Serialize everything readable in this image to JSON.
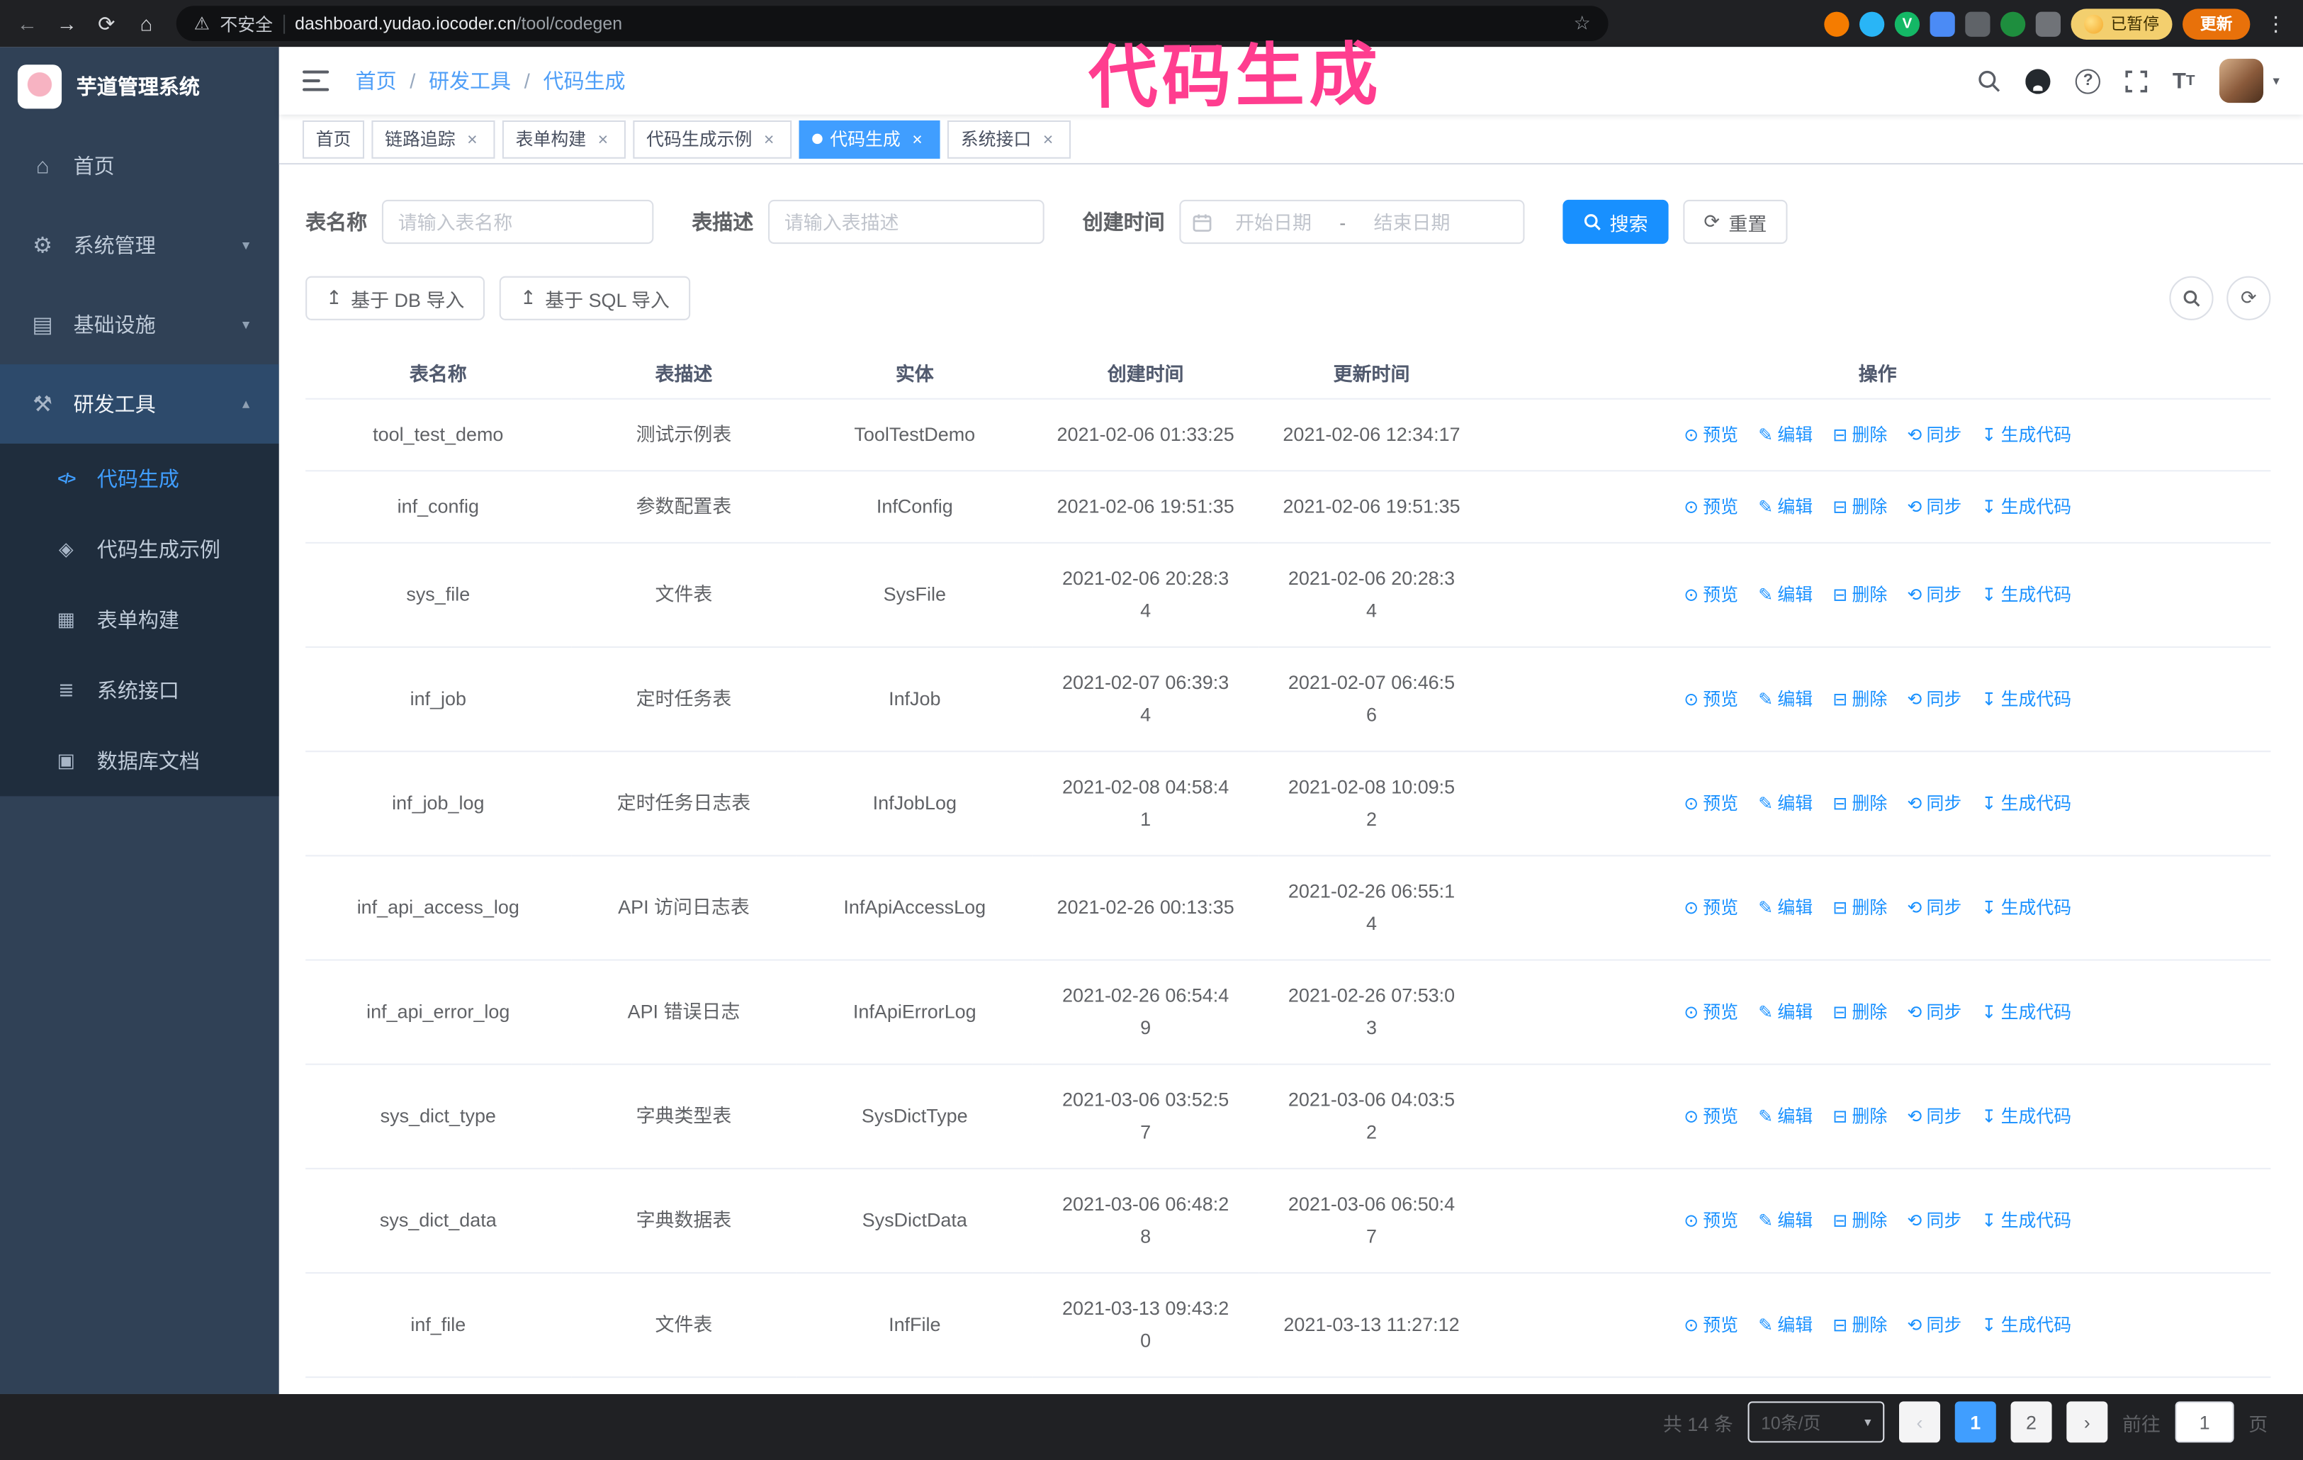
{
  "annotation": {
    "text": "代码生成"
  },
  "browser": {
    "security_label": "不安全",
    "url_host": "dashboard.yudao.iocoder.cn",
    "url_path": "/tool/codegen",
    "paused_badge": "已暂停",
    "update_button": "更新"
  },
  "icons": {
    "back": "←",
    "forward": "→",
    "reload": "⟳",
    "home": "⌂",
    "warning": "⚠",
    "star": "☆",
    "menu_dots": "⋮",
    "close": "×",
    "caret_down": "▾",
    "chevron_down": "▾",
    "chevron_up": "▴",
    "question": "?",
    "home_menu": "⌂",
    "gear": "⚙",
    "infra": "▤",
    "tools": "⚒",
    "code": "</>",
    "example": "◈",
    "form": "▦",
    "api": "≣",
    "dbdoc": "▣",
    "upload": "↥",
    "refresh": "⟳",
    "eye": "⊙",
    "edit": "✎",
    "delete": "⊟",
    "sync": "⟲",
    "download": "↧"
  },
  "sidebar": {
    "logo_title": "芋道管理系统",
    "items": [
      {
        "label": "首页"
      },
      {
        "label": "系统管理"
      },
      {
        "label": "基础设施"
      },
      {
        "label": "研发工具"
      }
    ],
    "submenu": [
      {
        "label": "代码生成"
      },
      {
        "label": "代码生成示例"
      },
      {
        "label": "表单构建"
      },
      {
        "label": "系统接口"
      },
      {
        "label": "数据库文档"
      }
    ]
  },
  "navbar": {
    "breadcrumb": [
      "首页",
      "研发工具",
      "代码生成"
    ],
    "separator": "/"
  },
  "tabs": [
    {
      "label": "首页"
    },
    {
      "label": "链路追踪"
    },
    {
      "label": "表单构建"
    },
    {
      "label": "代码生成示例"
    },
    {
      "label": "代码生成"
    },
    {
      "label": "系统接口"
    }
  ],
  "search_form": {
    "table_name_label": "表名称",
    "table_name_placeholder": "请输入表名称",
    "table_desc_label": "表描述",
    "table_desc_placeholder": "请输入表描述",
    "create_time_label": "创建时间",
    "date_start_placeholder": "开始日期",
    "date_separator": "-",
    "date_end_placeholder": "结束日期",
    "search_button": "搜索",
    "reset_button": "重置"
  },
  "toolbar": {
    "import_db_button": "基于 DB 导入",
    "import_sql_button": "基于 SQL 导入"
  },
  "table": {
    "columns": [
      "表名称",
      "表描述",
      "实体",
      "创建时间",
      "更新时间",
      "操作"
    ],
    "actions": [
      "预览",
      "编辑",
      "删除",
      "同步",
      "生成代码"
    ],
    "rows": [
      {
        "name": "tool_test_demo",
        "desc": "测试示例表",
        "entity": "ToolTestDemo",
        "create_time": "2021-02-06 01:33:25",
        "update_time": "2021-02-06 12:34:17"
      },
      {
        "name": "inf_config",
        "desc": "参数配置表",
        "entity": "InfConfig",
        "create_time": "2021-02-06 19:51:35",
        "update_time": "2021-02-06 19:51:35"
      },
      {
        "name": "sys_file",
        "desc": "文件表",
        "entity": "SysFile",
        "create_time": "2021-02-06 20:28:3\n4",
        "update_time": "2021-02-06 20:28:3\n4"
      },
      {
        "name": "inf_job",
        "desc": "定时任务表",
        "entity": "InfJob",
        "create_time": "2021-02-07 06:39:3\n4",
        "update_time": "2021-02-07 06:46:5\n6"
      },
      {
        "name": "inf_job_log",
        "desc": "定时任务日志表",
        "entity": "InfJobLog",
        "create_time": "2021-02-08 04:58:4\n1",
        "update_time": "2021-02-08 10:09:5\n2"
      },
      {
        "name": "inf_api_access_log",
        "desc": "API 访问日志表",
        "entity": "InfApiAccessLog",
        "create_time": "2021-02-26 00:13:35",
        "update_time": "2021-02-26 06:55:1\n4"
      },
      {
        "name": "inf_api_error_log",
        "desc": "API 错误日志",
        "entity": "InfApiErrorLog",
        "create_time": "2021-02-26 06:54:4\n9",
        "update_time": "2021-02-26 07:53:0\n3"
      },
      {
        "name": "sys_dict_type",
        "desc": "字典类型表",
        "entity": "SysDictType",
        "create_time": "2021-03-06 03:52:5\n7",
        "update_time": "2021-03-06 04:03:5\n2"
      },
      {
        "name": "sys_dict_data",
        "desc": "字典数据表",
        "entity": "SysDictData",
        "create_time": "2021-03-06 06:48:2\n8",
        "update_time": "2021-03-06 06:50:4\n7"
      },
      {
        "name": "inf_file",
        "desc": "文件表",
        "entity": "InfFile",
        "create_time": "2021-03-13 09:43:2\n0",
        "update_time": "2021-03-13 11:27:12"
      }
    ]
  },
  "pagination": {
    "total_text": "共 14 条",
    "page_size": "10条/页",
    "pages": [
      "1",
      "2"
    ],
    "goto_label": "前往",
    "goto_value": "1",
    "goto_suffix": "页"
  },
  "colors": {
    "primary": "#1890ff",
    "tab_active_bg": "#409EFF",
    "sidebar_bg": "#304156",
    "submenu_bg": "#1f2d3d",
    "annotation_pink": "#ff3d8f"
  }
}
